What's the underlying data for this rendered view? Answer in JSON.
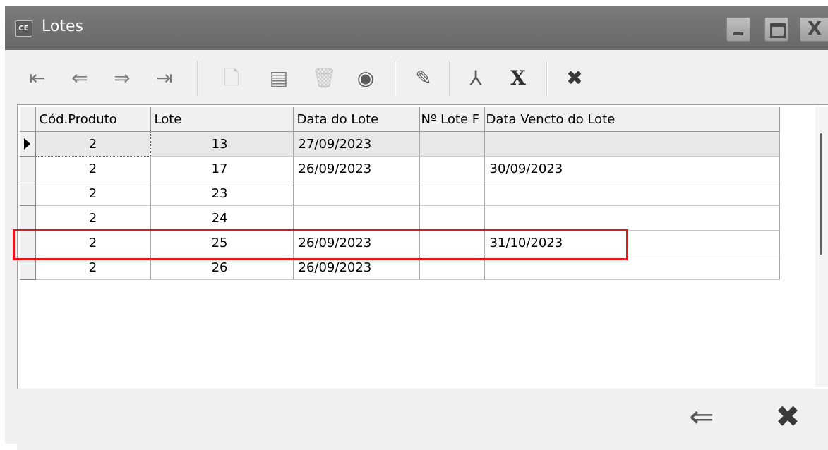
{
  "window": {
    "icon_text": "CE",
    "title": "Lotes",
    "controls": {
      "minimize": "minimize",
      "maximize": "maximize",
      "close": "X"
    }
  },
  "toolbar": {
    "buttons": [
      {
        "icon": "first-record-icon",
        "glyph": "⇤"
      },
      {
        "icon": "previous-record-icon",
        "glyph": "⇐"
      },
      {
        "icon": "next-record-icon",
        "glyph": "⇒"
      },
      {
        "icon": "last-record-icon",
        "glyph": "⇥"
      },
      {
        "icon": "new-document-icon",
        "glyph": "🗋"
      },
      {
        "icon": "print-icon",
        "glyph": "▤"
      },
      {
        "icon": "delete-icon",
        "glyph": "🗑"
      },
      {
        "icon": "view-icon",
        "glyph": "◉"
      },
      {
        "icon": "edit-icon",
        "glyph": "✎"
      },
      {
        "icon": "pdf-icon",
        "glyph": "⅄"
      },
      {
        "icon": "excel-icon",
        "glyph": "X"
      },
      {
        "icon": "cancel-icon",
        "glyph": "✖"
      }
    ]
  },
  "grid": {
    "columns": [
      "Cód.Produto",
      "Lote",
      "Data do Lote",
      "Nº Lote F",
      "Data Vencto do Lote"
    ],
    "rows": [
      {
        "cod": "2",
        "lote": "13",
        "data": "27/09/2023",
        "nlote": "",
        "venc": ""
      },
      {
        "cod": "2",
        "lote": "17",
        "data": "26/09/2023",
        "nlote": "",
        "venc": "30/09/2023"
      },
      {
        "cod": "2",
        "lote": "23",
        "data": "",
        "nlote": "",
        "venc": ""
      },
      {
        "cod": "2",
        "lote": "24",
        "data": "",
        "nlote": "",
        "venc": ""
      },
      {
        "cod": "2",
        "lote": "25",
        "data": "26/09/2023",
        "nlote": "",
        "venc": "31/10/2023"
      },
      {
        "cod": "2",
        "lote": "26",
        "data": "26/09/2023",
        "nlote": "",
        "venc": ""
      }
    ],
    "selected_row": 0,
    "highlighted_row": 4
  },
  "footer": {
    "back_glyph": "⇐",
    "close_glyph": "✖"
  },
  "colors": {
    "title_bar": "#707070",
    "highlight": "#e8161a"
  }
}
